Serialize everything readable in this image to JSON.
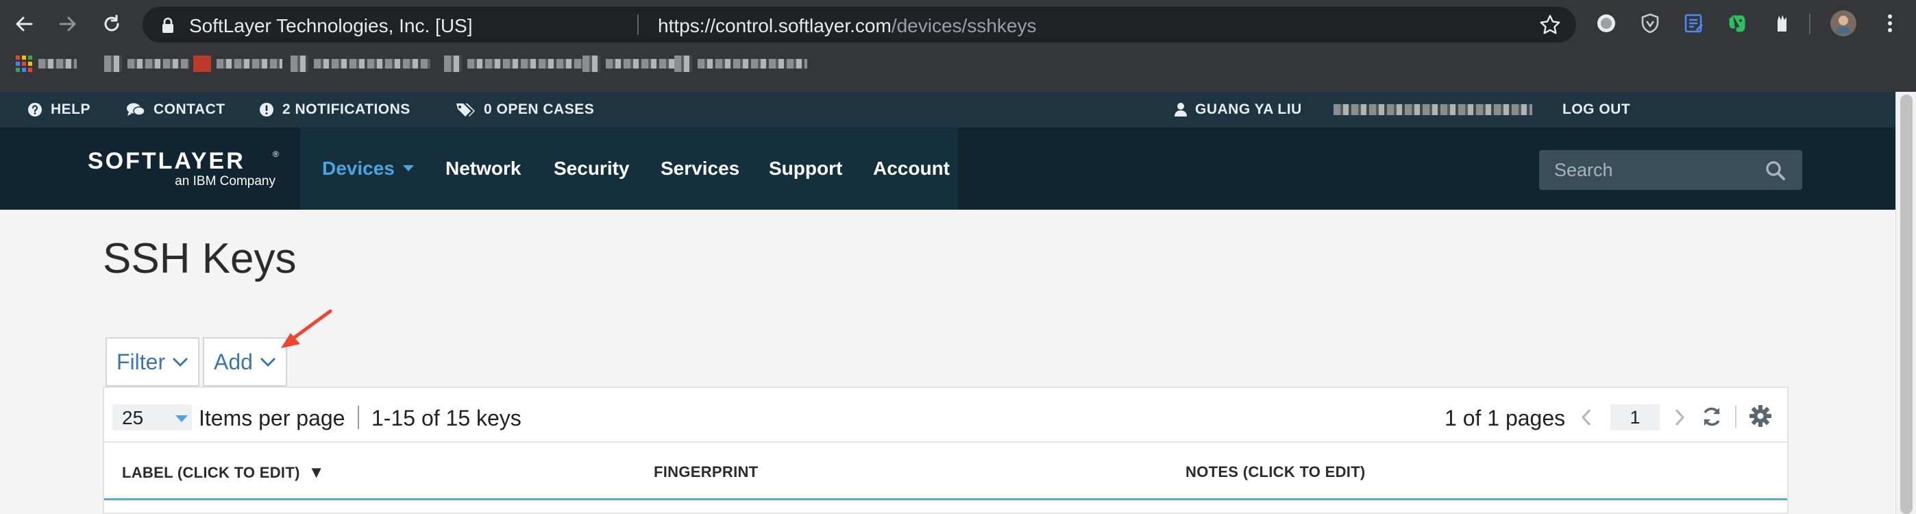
{
  "browser": {
    "site_identity": "SoftLayer Technologies, Inc. [US]",
    "url_host": "https://control.softlayer.com",
    "url_path": "/devices/sshkeys"
  },
  "topbar": {
    "help": "HELP",
    "contact": "CONTACT",
    "notifications": "2 NOTIFICATIONS",
    "open_cases": "0 OPEN CASES",
    "user": "GUANG YA LIU",
    "logout": "LOG OUT"
  },
  "brand": {
    "name": "SOFTLAYER",
    "tagline": "an IBM Company"
  },
  "nav": {
    "devices": "Devices",
    "network": "Network",
    "security": "Security",
    "services": "Services",
    "support": "Support",
    "account": "Account",
    "search_placeholder": "Search"
  },
  "page": {
    "title": "SSH Keys",
    "filter_label": "Filter",
    "add_label": "Add"
  },
  "pager": {
    "per_page_value": "25",
    "items_per_page": "Items per page",
    "range": "1-15 of 15 keys",
    "pages": "1 of 1 pages",
    "current_page": "1"
  },
  "table": {
    "columns": [
      "LABEL (CLICK TO EDIT)",
      "FINGERPRINT",
      "NOTES (CLICK TO EDIT)"
    ]
  },
  "colors": {
    "topbar_bg": "#1e3441",
    "nav_bg": "#10252f",
    "accent": "#4fa3e0",
    "annotation_arrow": "#ee4430"
  }
}
